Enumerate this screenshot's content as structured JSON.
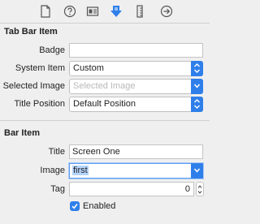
{
  "toolbar": {
    "icons": [
      "file-icon",
      "help-icon",
      "identity-icon",
      "attributes-icon",
      "size-ruler-icon",
      "connections-icon"
    ],
    "selected_icon": "attributes-icon",
    "accent_color": "#2f7fea"
  },
  "tab_bar_item": {
    "section_title": "Tab Bar Item",
    "badge": {
      "label": "Badge",
      "value": ""
    },
    "system_item": {
      "label": "System Item",
      "value": "Custom"
    },
    "selected_image": {
      "label": "Selected Image",
      "placeholder": "Selected Image"
    },
    "title_position": {
      "label": "Title Position",
      "value": "Default Position"
    }
  },
  "bar_item": {
    "section_title": "Bar Item",
    "title": {
      "label": "Title",
      "value": "Screen One"
    },
    "image": {
      "label": "Image",
      "value": "first"
    },
    "tag": {
      "label": "Tag",
      "value": "0"
    },
    "enabled": {
      "label": "Enabled",
      "checked": true
    }
  }
}
